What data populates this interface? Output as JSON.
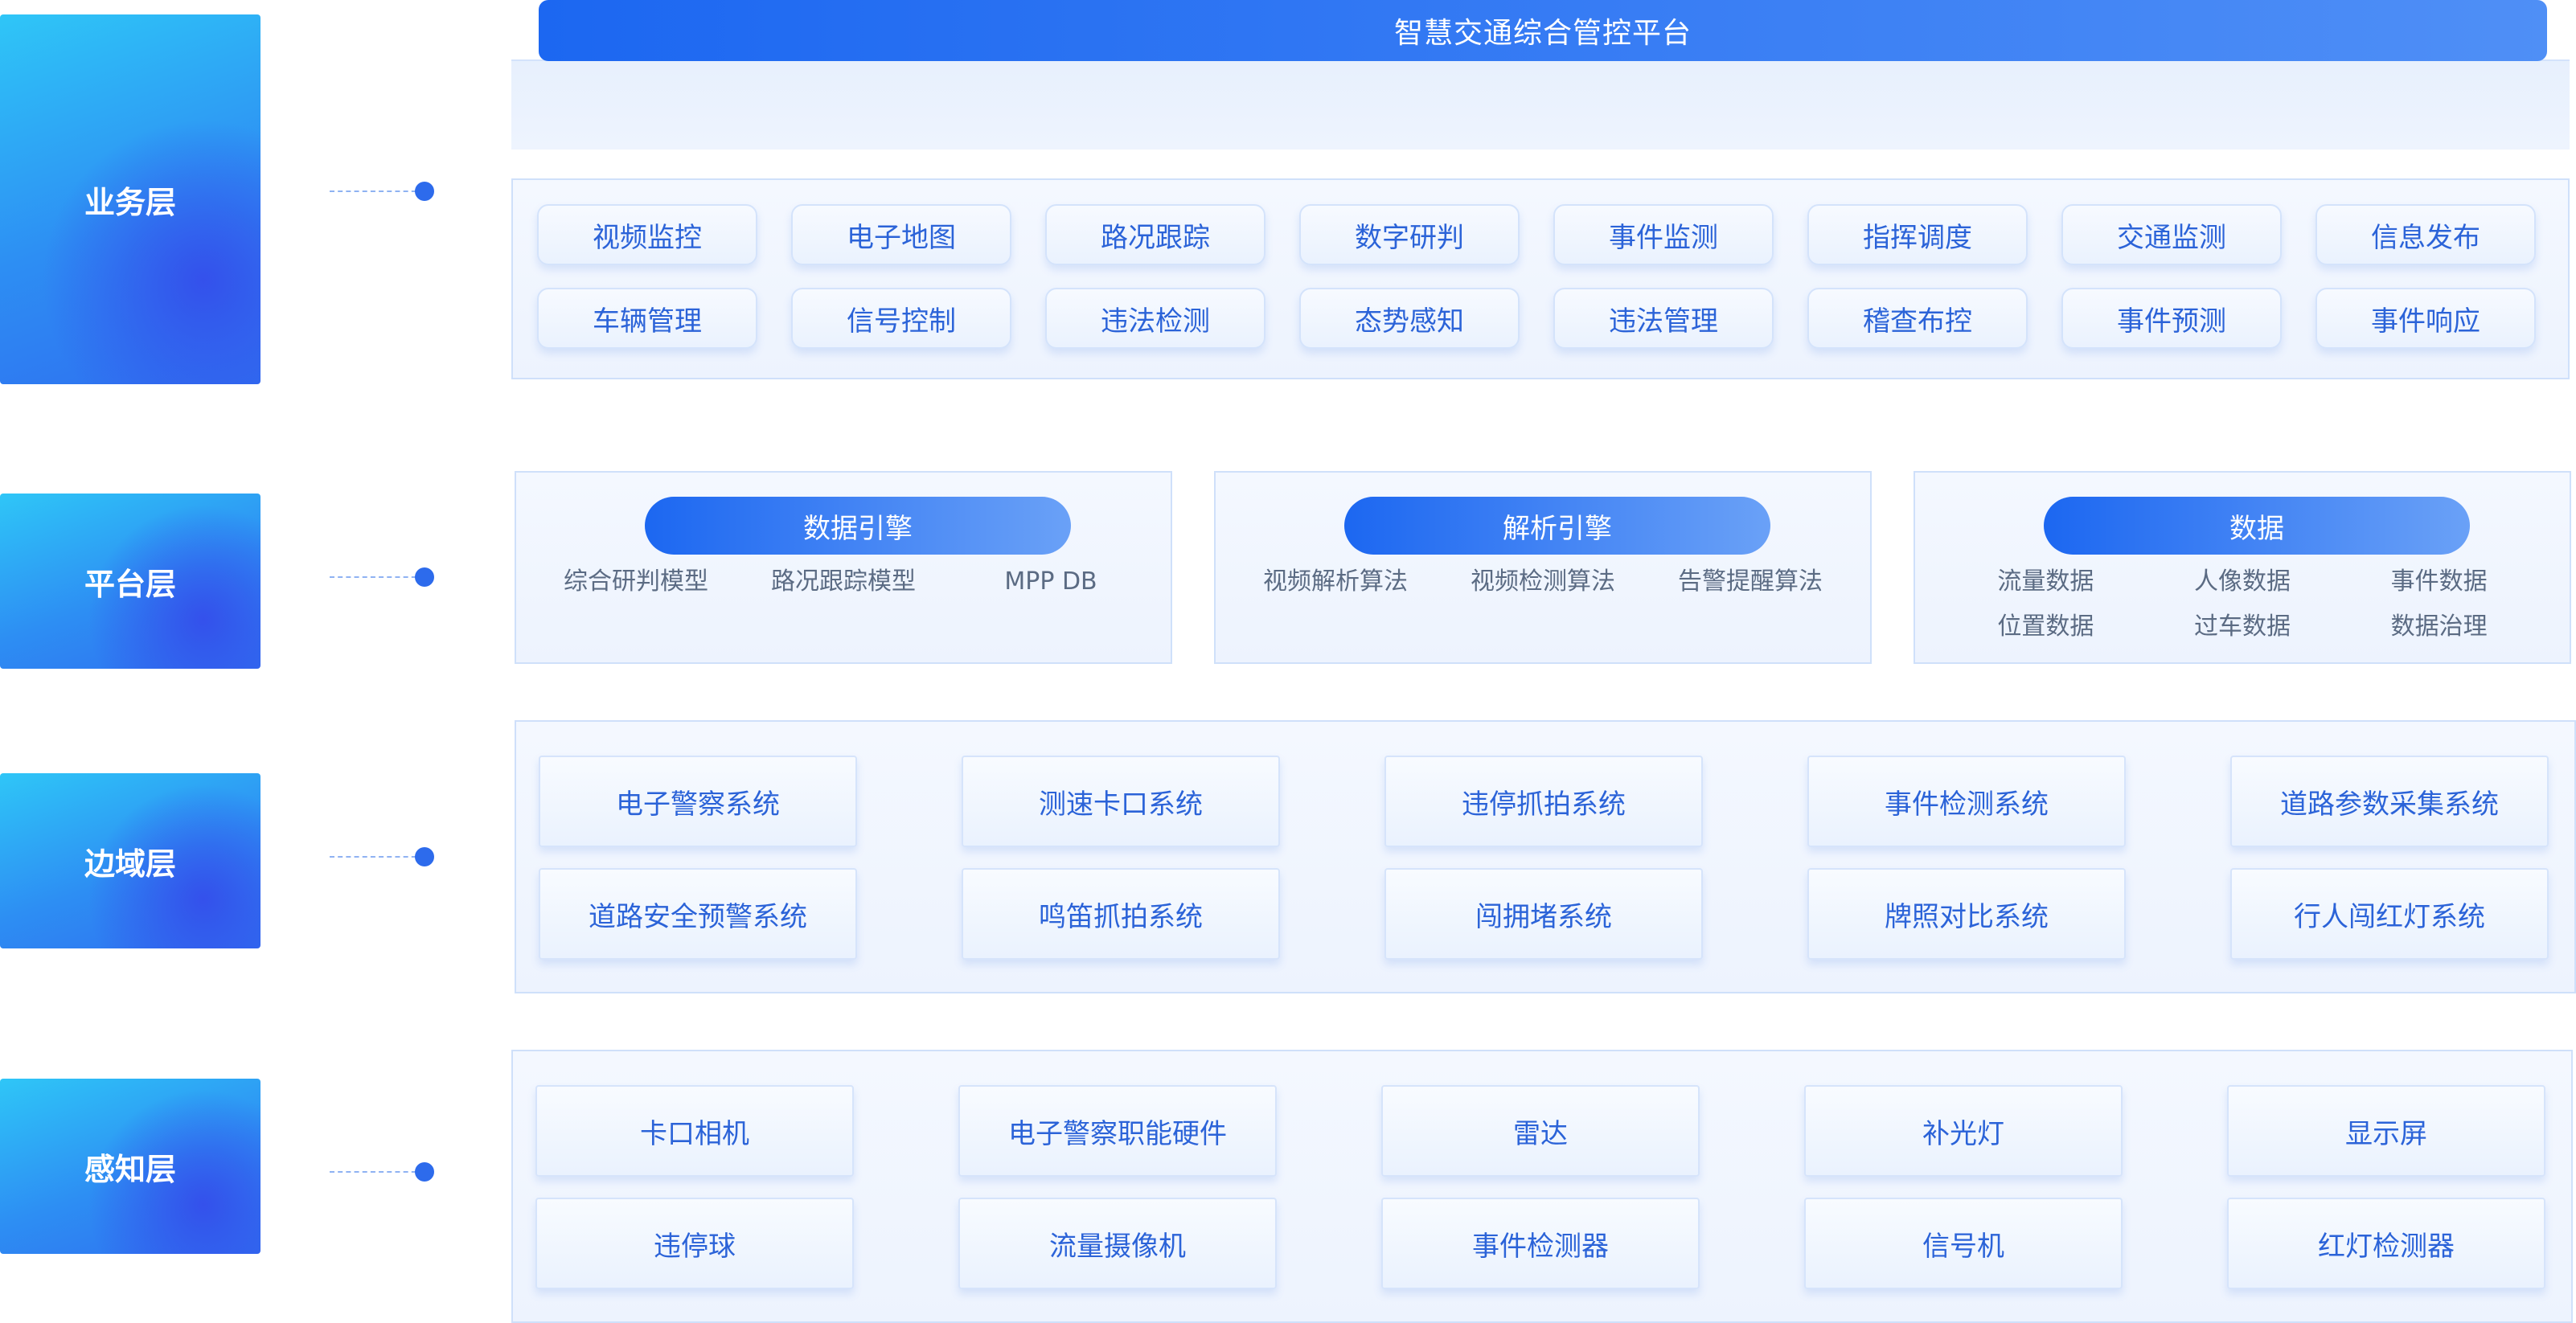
{
  "banner": {
    "title": "智慧交通综合管控平台"
  },
  "layers": [
    {
      "label": "业务层"
    },
    {
      "label": "平台层"
    },
    {
      "label": "边域层"
    },
    {
      "label": "感知层"
    }
  ],
  "business": {
    "items": [
      "视频监控",
      "电子地图",
      "路况跟踪",
      "数字研判",
      "事件监测",
      "指挥调度",
      "交通监测",
      "信息发布",
      "车辆管理",
      "信号控制",
      "违法检测",
      "态势感知",
      "违法管理",
      "稽查布控",
      "事件预测",
      "事件响应"
    ]
  },
  "platform": {
    "engines": [
      {
        "title": "数据引擎",
        "items": [
          "综合研判模型",
          "路况跟踪模型",
          "MPP DB"
        ]
      },
      {
        "title": "解析引擎",
        "items": [
          "视频解析算法",
          "视频检测算法",
          "告警提醒算法"
        ]
      },
      {
        "title": "数据",
        "items": [
          "流量数据",
          "人像数据",
          "事件数据",
          "位置数据",
          "过车数据",
          "数据治理"
        ]
      }
    ]
  },
  "edge": {
    "items": [
      "电子警察系统",
      "测速卡口系统",
      "违停抓拍系统",
      "事件检测系统",
      "道路参数采集系统",
      "道路安全预警系统",
      "鸣笛抓拍系统",
      "闯拥堵系统",
      "牌照对比系统",
      "行人闯红灯系统"
    ]
  },
  "sensing": {
    "items": [
      "卡口相机",
      "电子警察职能硬件",
      "雷达",
      "补光灯",
      "显示屏",
      "违停球",
      "流量摄像机",
      "事件检测器",
      "信号机",
      "红灯检测器"
    ]
  }
}
